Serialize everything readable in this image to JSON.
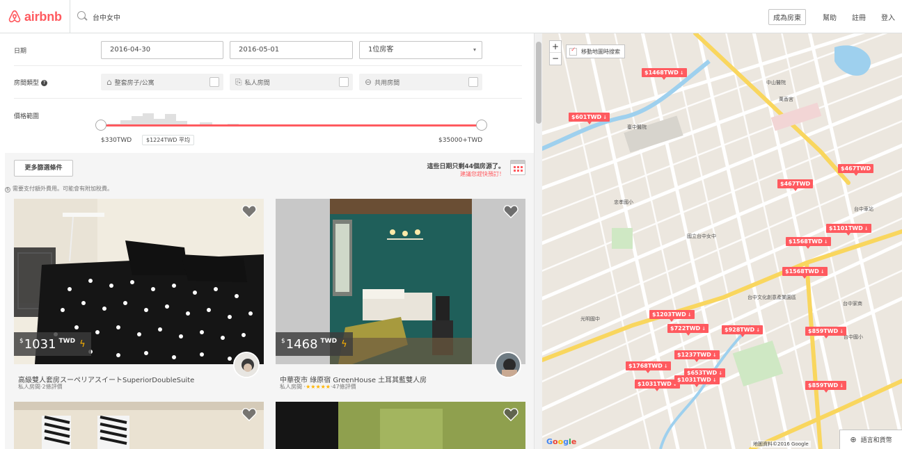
{
  "header": {
    "logo_text": "airbnb",
    "search_value": "台中女中",
    "host_button": "成為房東",
    "nav": [
      "幫助",
      "註冊",
      "登入"
    ]
  },
  "filters": {
    "date_label": "日期",
    "checkin": "2016-04-30",
    "checkout": "2016-05-01",
    "guests": "1位房客",
    "room_type_label": "房間類型",
    "room_types": [
      {
        "label": "整套房子/公寓",
        "icon": "house-icon"
      },
      {
        "label": "私人房間",
        "icon": "door-icon"
      },
      {
        "label": "共用房間",
        "icon": "couch-icon"
      }
    ],
    "price_label": "價格範圍",
    "price_min": "$330TWD",
    "price_avg": "$1224TWD 平均",
    "price_max": "$35000+TWD"
  },
  "listings_bar": {
    "more_filters": "更多篩選條件",
    "availability": "這些日期只剩44個房源了。",
    "book_soon": "建議您趕快預訂！",
    "fee_note": "需要支付額外費用。可能會有附加稅費。"
  },
  "cards": [
    {
      "price_currency": "$",
      "price": "1031",
      "unit": "TWD",
      "title": "高級雙人套房スーペリアスイートSuperiorDoubleSuite",
      "type": "私人房間",
      "stars": "",
      "reviews": "·2條評價"
    },
    {
      "price_currency": "$",
      "price": "1468",
      "unit": "TWD",
      "title": "中華夜市 綠原宿 GreenHouse 土耳其藍雙人房",
      "type": "私人房間 ·",
      "stars": "★★★★★",
      "reviews": "·47條評價"
    }
  ],
  "map": {
    "move_search": "移動地圖時搜索",
    "language": "語言和貨幣",
    "attribution": "地圖資料©2016 Google",
    "pins": [
      "$1468TWD",
      "$601TWD",
      "$467TWD",
      "$467TWD",
      "$1101TWD",
      "$1568TWD",
      "$1568TWD",
      "$1203TWD",
      "$722TWD",
      "$928TWD",
      "$859TWD",
      "$1237TWD",
      "$1768TWD",
      "$653TWD",
      "$1031TWD",
      "$1031TWD",
      "$859TWD"
    ],
    "labels": [
      "中山醫院",
      "臺中醫院",
      "國立台中女中",
      "台中車站",
      "台中文化創意產業園區",
      "光明國中",
      "忠孝國小",
      "台中國小",
      "萬香宮",
      "台中家商",
      "中華路"
    ]
  },
  "colors": {
    "brand": "#ff5a5f",
    "star": "#ffb400"
  }
}
